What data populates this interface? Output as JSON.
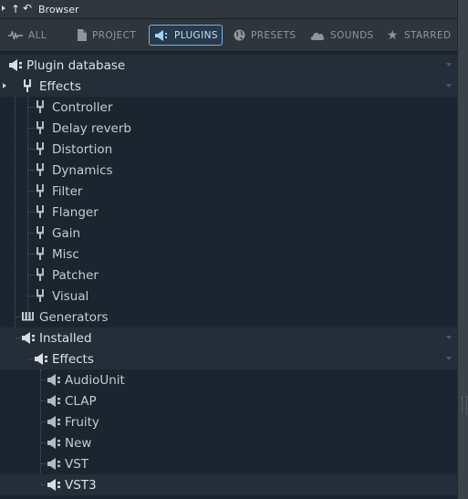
{
  "titlebar": {
    "title": "Browser"
  },
  "tabs": [
    {
      "label": "ALL",
      "icon": "waveform-icon",
      "active": false
    },
    {
      "label": "PROJECT",
      "icon": "document-icon",
      "active": false
    },
    {
      "label": "PLUGINS",
      "icon": "plug-icon",
      "active": true
    },
    {
      "label": "PRESETS",
      "icon": "globe-icon",
      "active": false
    },
    {
      "label": "SOUNDS",
      "icon": "cloud-icon",
      "active": false
    },
    {
      "label": "STARRED",
      "icon": "star-icon",
      "active": false
    }
  ],
  "tree": {
    "root": "Plugin database",
    "effects_folder": "Effects",
    "effects_items": [
      "Controller",
      "Delay reverb",
      "Distortion",
      "Dynamics",
      "Filter",
      "Flanger",
      "Gain",
      "Misc",
      "Patcher",
      "Visual"
    ],
    "generators": "Generators",
    "installed": "Installed",
    "installed_effects": "Effects",
    "installed_effects_items": [
      "AudioUnit",
      "CLAP",
      "Fruity",
      "New",
      "VST",
      "VST3"
    ]
  },
  "colors": {
    "accent": "#6cb5f0",
    "background": "#1b2530",
    "folder_row": "#232e38"
  }
}
